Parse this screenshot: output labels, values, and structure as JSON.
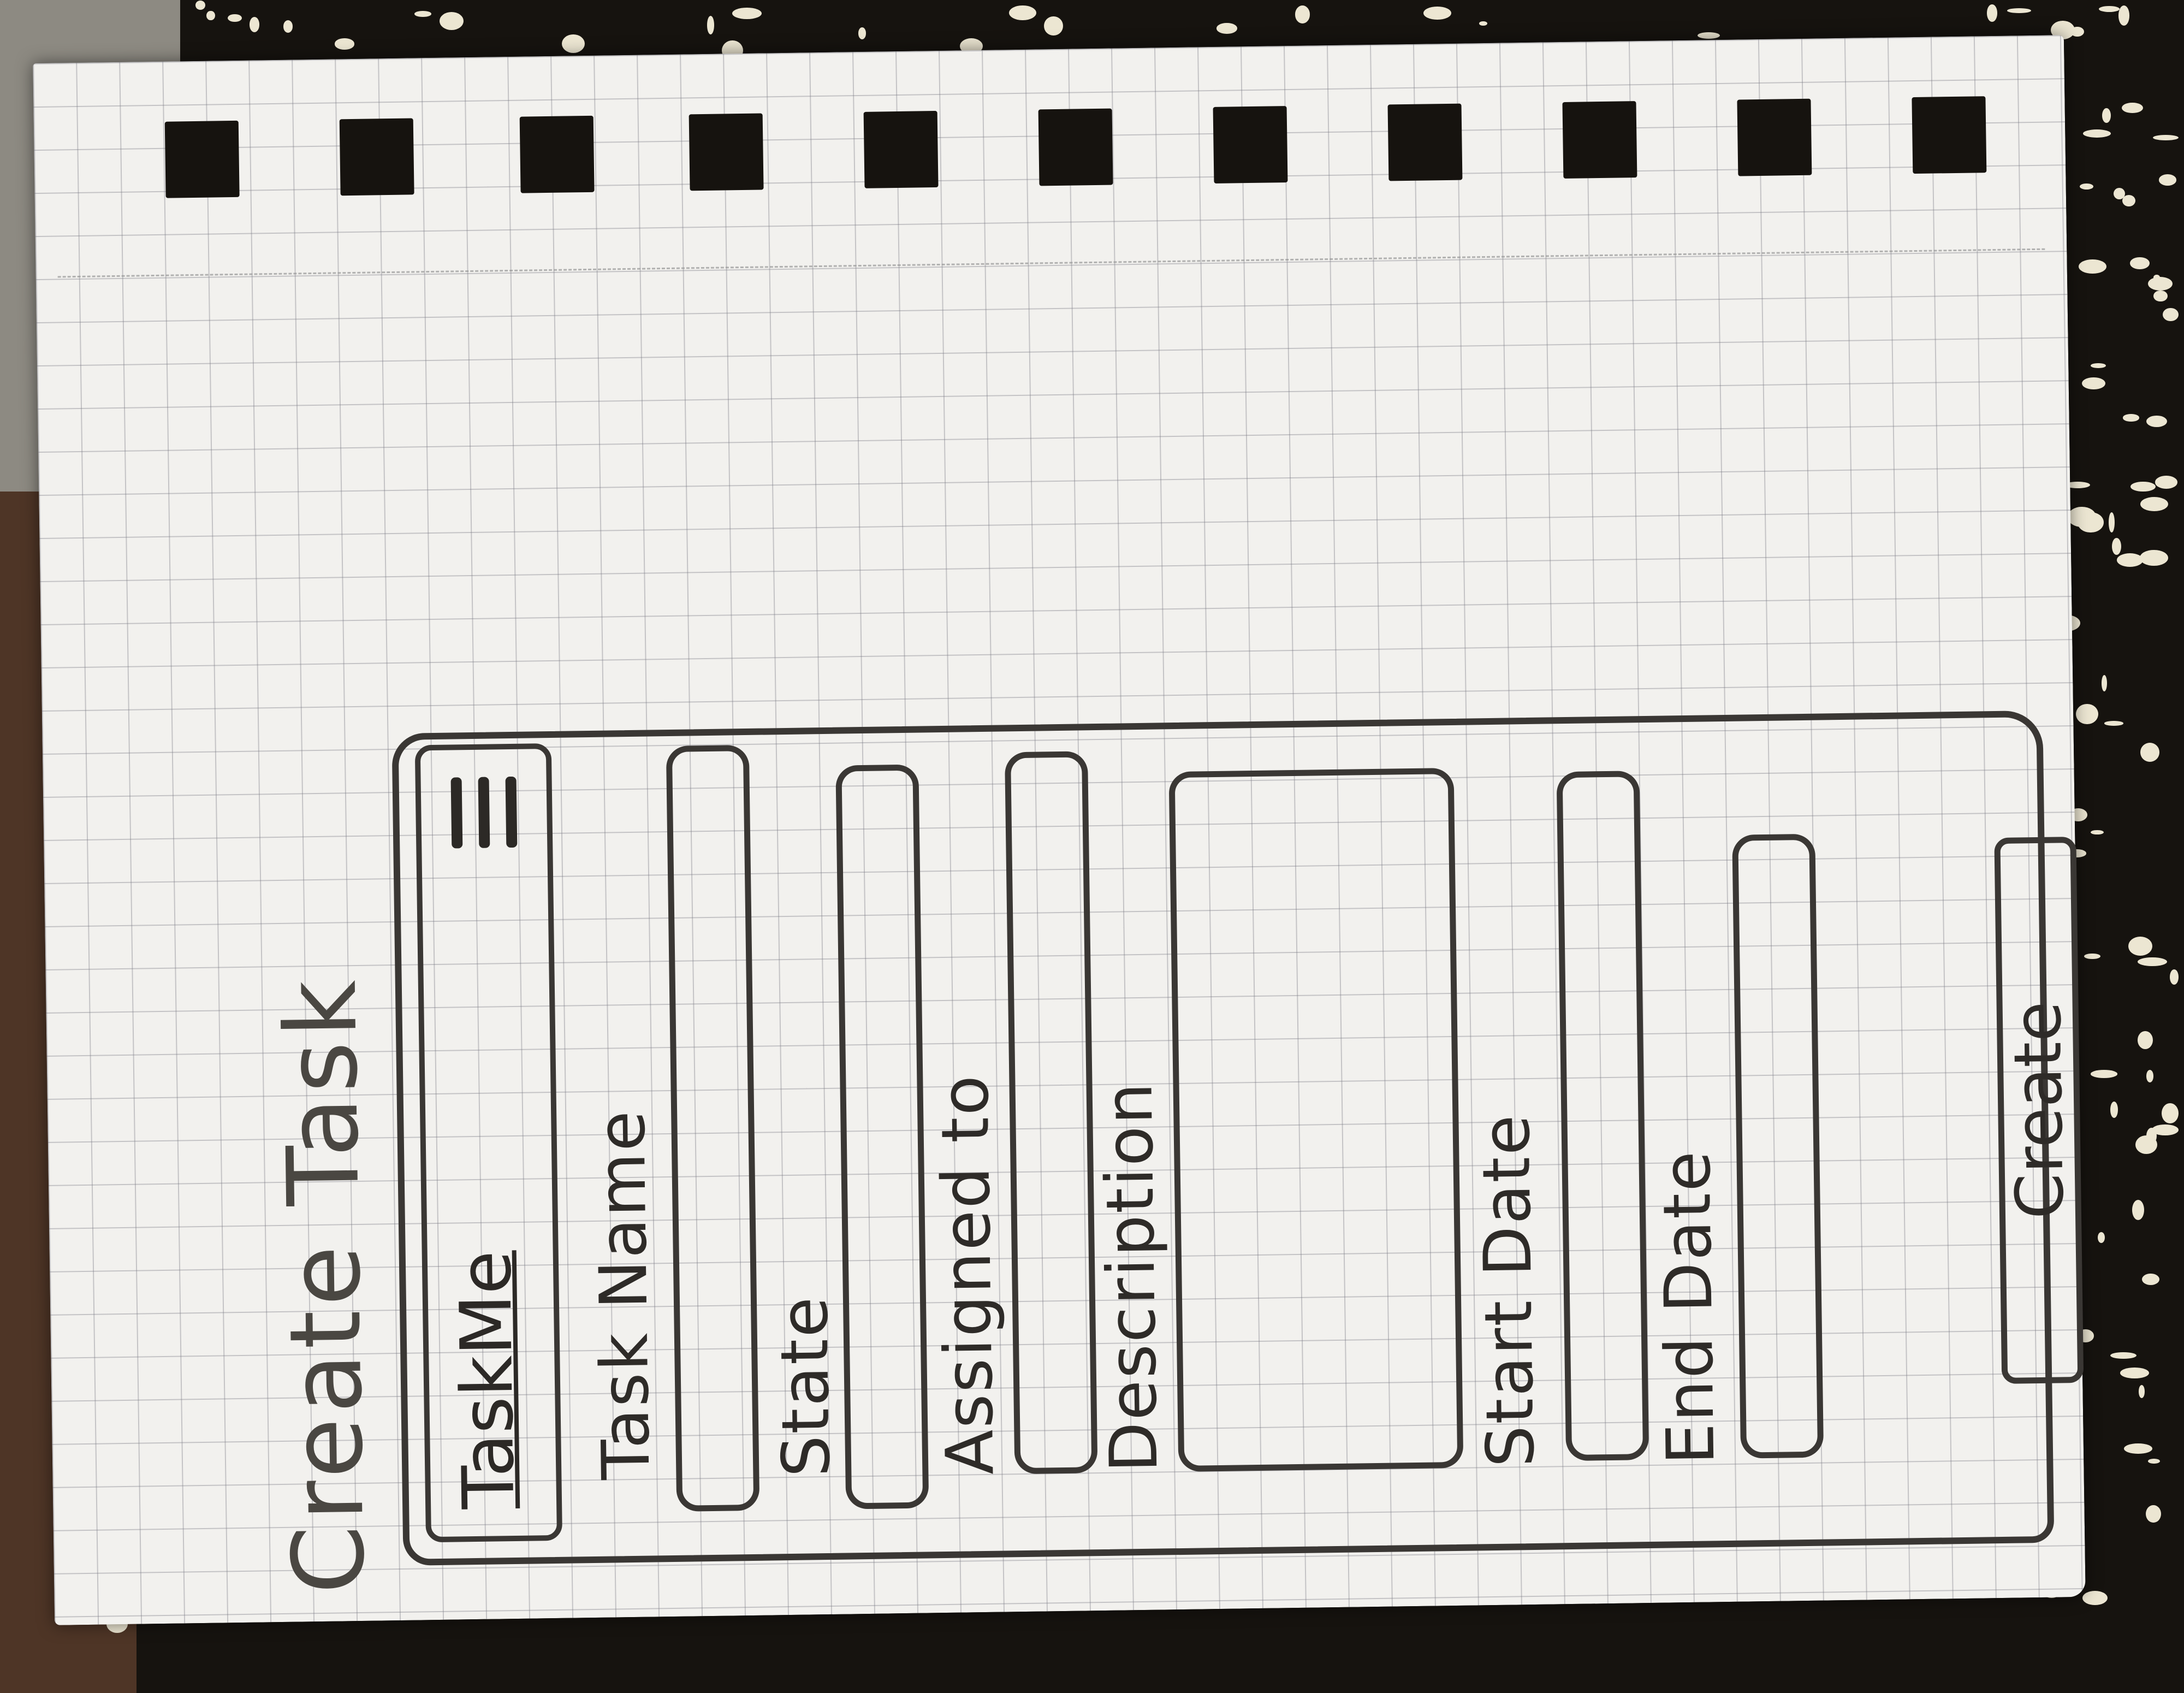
{
  "sketch": {
    "screen_title": "Create Task",
    "app_name": "TaskMe",
    "icons": {
      "menu": "hamburger-menu-icon"
    },
    "fields": [
      {
        "label": "Task Name"
      },
      {
        "label": "State"
      },
      {
        "label": "Assigned to"
      },
      {
        "label": "Description"
      },
      {
        "label": "Start Date"
      },
      {
        "label": "End Date"
      }
    ],
    "create_label": "Create"
  }
}
